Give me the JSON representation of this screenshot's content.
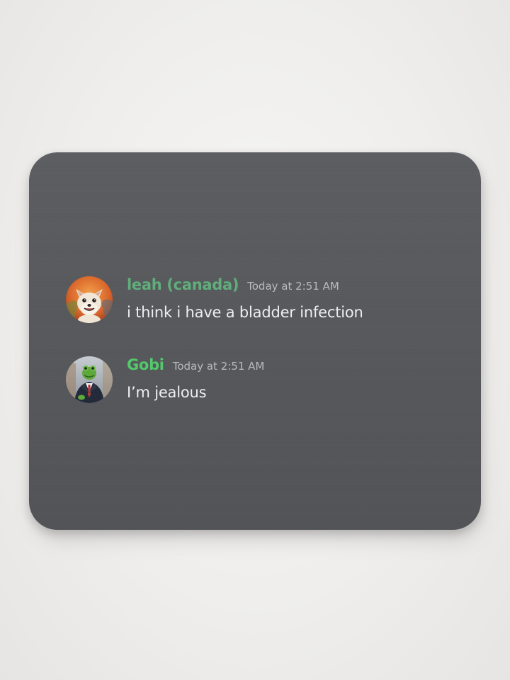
{
  "messages": [
    {
      "username": "leah (canada)",
      "username_color": "#5fae7b",
      "timestamp": "Today at 2:51 AM",
      "content": "i think i have a bladder infection",
      "avatar": "chihuahua-avatar"
    },
    {
      "username": "Gobi",
      "username_color": "#52c96a",
      "timestamp": "Today at 2:51 AM",
      "content": "I’m jealous",
      "avatar": "frog-in-suit-avatar"
    }
  ],
  "colors": {
    "pad": "#56585b",
    "timestamp": "#b7babe",
    "message_text": "#eceef0",
    "background": "#efeeec"
  }
}
